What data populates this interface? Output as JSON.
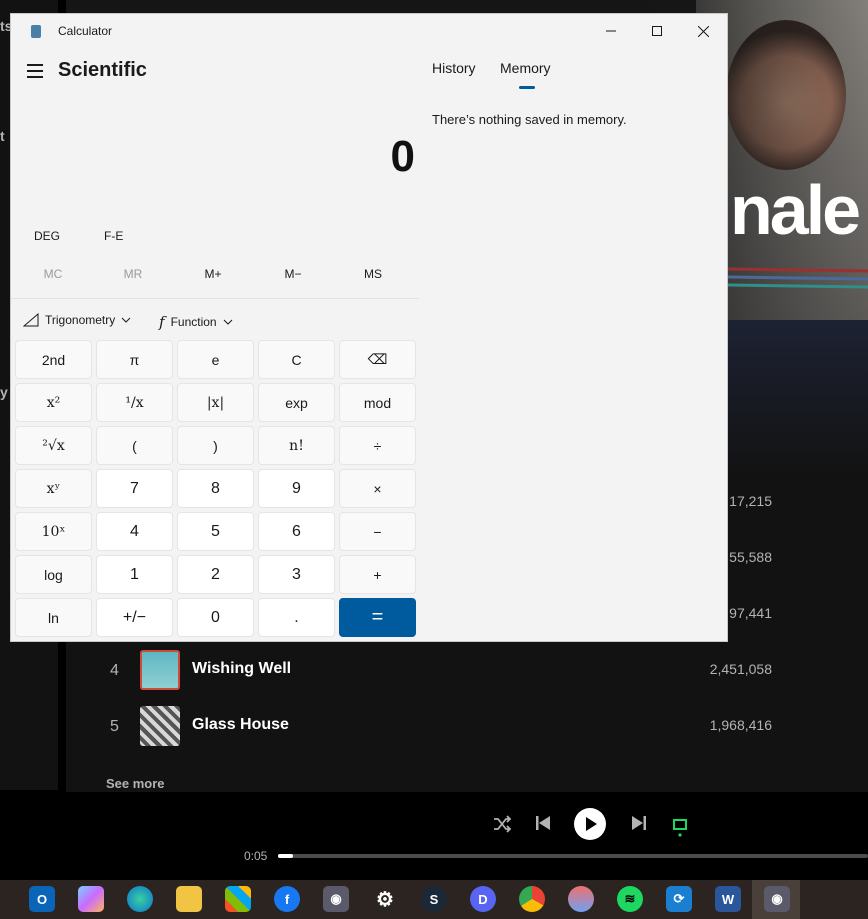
{
  "calculator": {
    "window_title": "Calculator",
    "mode": "Scientific",
    "display_value": "0",
    "angle_mode": "DEG",
    "fe_label": "F-E",
    "memory_buttons": [
      "MC",
      "MR",
      "M+",
      "M−",
      "MS"
    ],
    "dropdowns": {
      "trigonometry": "Trigonometry",
      "function": "Function"
    },
    "keys": [
      [
        "2nd",
        "π",
        "e",
        "C",
        "⌫"
      ],
      [
        "x²",
        "¹/x",
        "|x|",
        "exp",
        "mod"
      ],
      [
        "²√x",
        "(",
        ")",
        "n!",
        "÷"
      ],
      [
        "xʸ",
        "7",
        "8",
        "9",
        "×"
      ],
      [
        "10ˣ",
        "4",
        "5",
        "6",
        "−"
      ],
      [
        "log",
        "1",
        "2",
        "3",
        "+"
      ],
      [
        "ln",
        "+/−",
        "0",
        ".",
        "="
      ]
    ],
    "tabs": [
      "History",
      "Memory"
    ],
    "active_tab": "Memory",
    "memory_empty_text": "There’s nothing saved in memory.",
    "accent_color": "#005a9e"
  },
  "spotify": {
    "hero_title_fragment": "nale",
    "left_fragments": [
      "ts",
      "t",
      "y l"
    ],
    "tracks": [
      {
        "num": "",
        "title": "",
        "plays": "17,215"
      },
      {
        "num": "",
        "title": "",
        "plays": "55,588"
      },
      {
        "num": "",
        "title": "",
        "plays": "97,441"
      },
      {
        "num": "4",
        "title": "Wishing Well",
        "plays": "2,451,058"
      },
      {
        "num": "5",
        "title": "Glass House",
        "plays": "1,968,416"
      }
    ],
    "see_more": "See more",
    "playback": {
      "current_time": "0:05",
      "progress": 0.025
    },
    "icons": [
      "shuffle-icon",
      "previous-icon",
      "play-icon",
      "next-icon",
      "repeat-icon"
    ]
  },
  "taskbar": {
    "apps": [
      "outlook",
      "copilot",
      "edge",
      "file-explorer",
      "store",
      "messenger",
      "camera",
      "settings",
      "steam",
      "discord",
      "chrome",
      "paint",
      "spotify",
      "sync",
      "word",
      "camera"
    ],
    "active_app": "camera"
  }
}
